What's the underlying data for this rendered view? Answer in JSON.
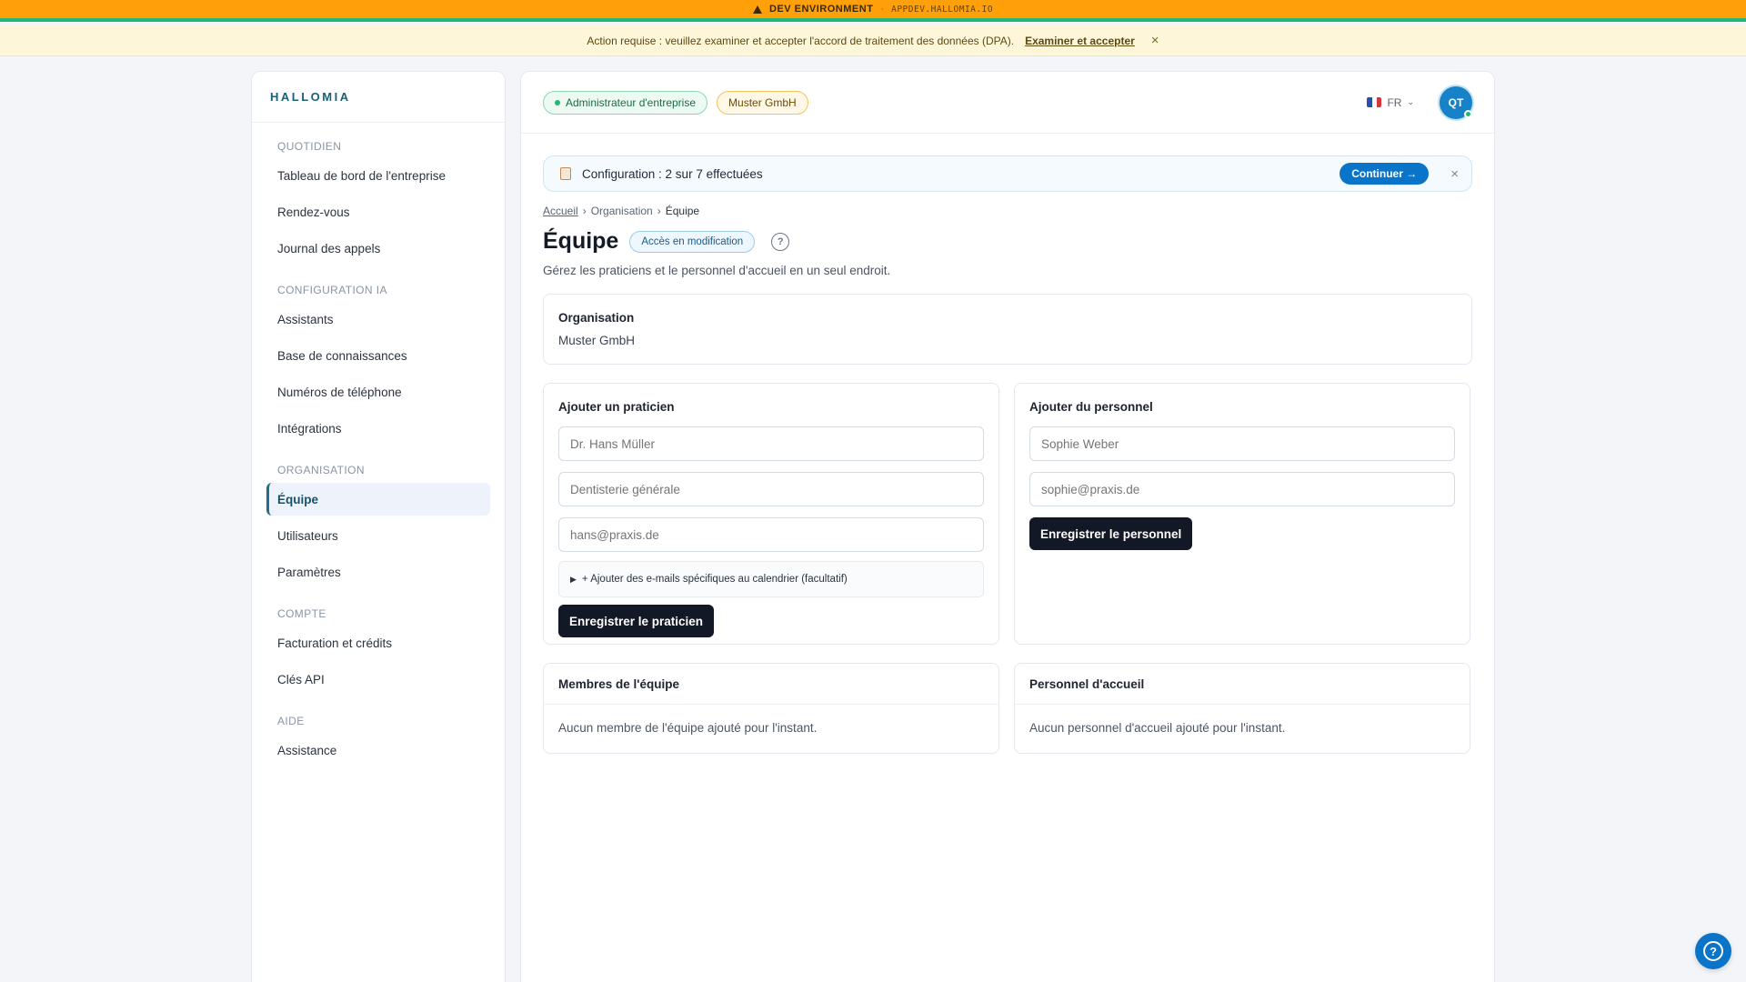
{
  "dev_banner": {
    "label": "DEV ENVIRONMENT",
    "separator": "·",
    "url": "APPDEV.HALLOMIA.IO"
  },
  "notice": {
    "text": "Action requise : veuillez examiner et accepter l'accord de traitement des données (DPA).",
    "link": "Examiner et accepter",
    "close": "×"
  },
  "sidebar": {
    "brand": "HALLOMIA",
    "sections": [
      {
        "title": "QUOTIDIEN",
        "items": [
          "Tableau de bord de l'entreprise",
          "Rendez-vous",
          "Journal des appels"
        ]
      },
      {
        "title": "CONFIGURATION IA",
        "items": [
          "Assistants",
          "Base de connaissances",
          "Numéros de téléphone",
          "Intégrations"
        ]
      },
      {
        "title": "ORGANISATION",
        "items": [
          "Équipe",
          "Utilisateurs",
          "Paramètres"
        ]
      },
      {
        "title": "COMPTE",
        "items": [
          "Facturation et crédits",
          "Clés API"
        ]
      },
      {
        "title": "AIDE",
        "items": [
          "Assistance"
        ]
      }
    ],
    "active_item": "Équipe"
  },
  "topbar": {
    "role_badge": "Administrateur d'entreprise",
    "org_badge": "Muster GmbH",
    "language": "FR",
    "avatar_initials": "QT"
  },
  "setup": {
    "text": "Configuration : 2 sur 7 effectuées",
    "button": "Continuer →",
    "close": "×"
  },
  "breadcrumb": {
    "home": "Accueil",
    "sep": "›",
    "org": "Organisation",
    "current": "Équipe"
  },
  "page": {
    "title": "Équipe",
    "access_badge": "Accès en modification",
    "help_icon": "?",
    "subtitle": "Gérez les praticiens et le personnel d'accueil en un seul endroit."
  },
  "org_card": {
    "title": "Organisation",
    "value": "Muster GmbH"
  },
  "practitioner_form": {
    "title": "Ajouter un praticien",
    "name_placeholder": "Dr. Hans Müller",
    "specialty_placeholder": "Dentisterie générale",
    "email_placeholder": "hans@praxis.de",
    "details": "+ Ajouter des e-mails spécifiques au calendrier (facultatif)",
    "details_marker": "▶",
    "submit": "Enregistrer le praticien"
  },
  "staff_form": {
    "title": "Ajouter du personnel",
    "name_placeholder": "Sophie Weber",
    "email_placeholder": "sophie@praxis.de",
    "submit": "Enregistrer le personnel"
  },
  "team_members": {
    "title": "Membres de l'équipe",
    "empty": "Aucun membre de l'équipe ajouté pour l'instant."
  },
  "reception_staff": {
    "title": "Personnel d'accueil",
    "empty": "Aucun personnel d'accueil ajouté pour l'instant."
  },
  "help_fab_icon": "?",
  "colors": {
    "dev_bar": "#ff9f0a",
    "accent": "#0a74c9",
    "brand": "#1a6178",
    "dark_button": "#121826"
  }
}
